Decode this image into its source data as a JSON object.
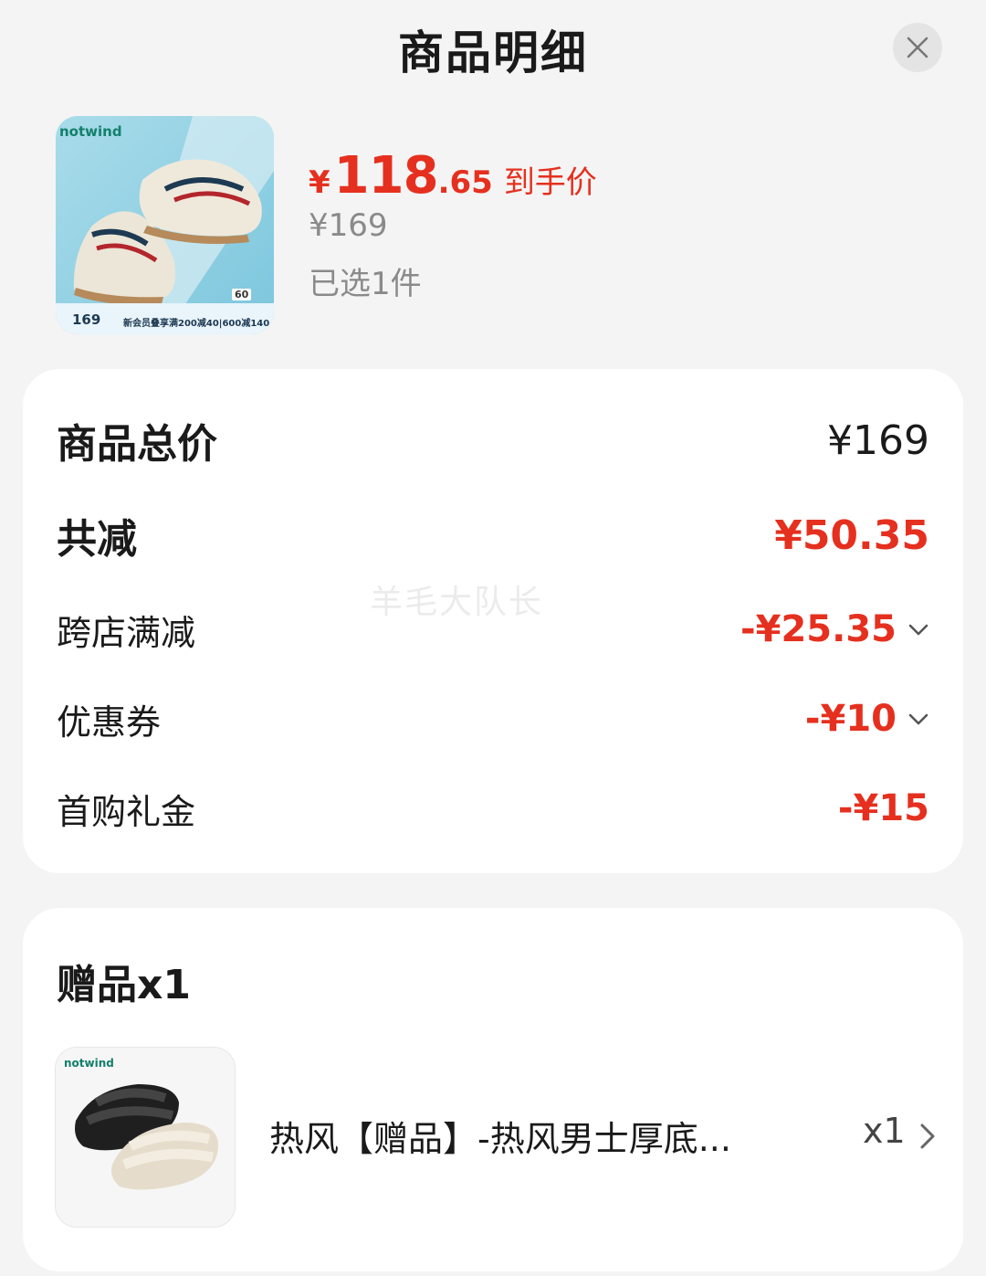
{
  "header": {
    "title": "商品明细"
  },
  "product": {
    "brand": "notwind",
    "thumb_price": "169",
    "thumb_promo": "新会员叠享满200减40|600减140",
    "thumb_badge": "60",
    "currency": "¥",
    "deal_price_int": "118",
    "deal_price_dec": ".65",
    "deal_label": "到手价",
    "original_price": "¥169",
    "selected_count": "已选1件"
  },
  "summary": {
    "rows": [
      {
        "label": "商品总价",
        "value": "¥169"
      },
      {
        "label": "共减",
        "value": "¥50.35"
      },
      {
        "label": "跨店满减",
        "value": "-¥25.35"
      },
      {
        "label": "优惠券",
        "value": "-¥10"
      },
      {
        "label": "首购礼金",
        "value": "-¥15"
      }
    ]
  },
  "watermark": "羊毛大队长",
  "gift": {
    "title": "赠品x1",
    "brand": "notwind",
    "name": "热风【赠品】-热风男士厚底...",
    "qty": "x1"
  },
  "colors": {
    "accent_red": "#e5301f",
    "muted_gray": "#8a8a8a",
    "background": "#f4f4f4"
  },
  "icons": {
    "close": "close-icon",
    "expand": "chevron-down-icon",
    "navigate": "chevron-right-icon"
  }
}
